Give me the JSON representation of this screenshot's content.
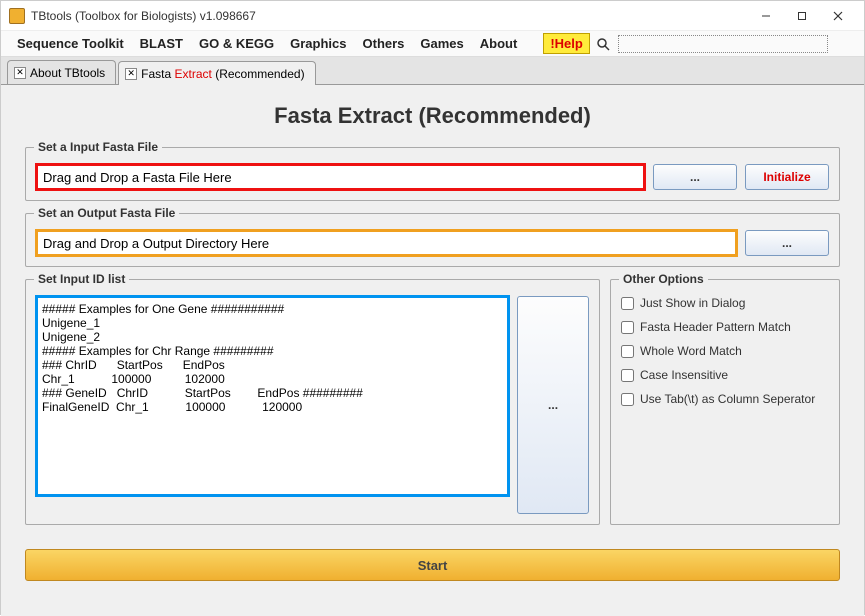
{
  "window": {
    "title": "TBtools (Toolbox for Biologists) v1.098667"
  },
  "menu": {
    "items": [
      "Sequence Toolkit",
      "BLAST",
      "GO & KEGG",
      "Graphics",
      "Others",
      "Games",
      "About"
    ],
    "help": "!Help"
  },
  "tabs": [
    {
      "label": "About TBtools"
    },
    {
      "prefix": "Fasta ",
      "highlight": "Extract",
      "suffix": " (Recommended)"
    }
  ],
  "page": {
    "title": "Fasta Extract (Recommended)"
  },
  "inputFasta": {
    "legend": "Set a Input Fasta File",
    "value": "Drag and Drop a Fasta File Here",
    "browse": "...",
    "initialize": "Initialize"
  },
  "outputFasta": {
    "legend": "Set an Output Fasta File",
    "value": "Drag and Drop a Output Directory Here",
    "browse": "..."
  },
  "idList": {
    "legend": "Set Input ID list",
    "content": "##### Examples for One Gene ###########\nUnigene_1\nUnigene_2\n##### Examples for Chr Range #########\n### ChrID      StartPos      EndPos\nChr_1           100000          102000\n### GeneID   ChrID           StartPos        EndPos #########\nFinalGeneID  Chr_1           100000           120000",
    "browse": "..."
  },
  "options": {
    "legend": "Other Options",
    "items": [
      "Just Show in Dialog",
      "Fasta Header Pattern Match",
      "Whole Word Match",
      "Case Insensitive",
      "Use Tab(\\t) as Column Seperator"
    ]
  },
  "start": "Start"
}
